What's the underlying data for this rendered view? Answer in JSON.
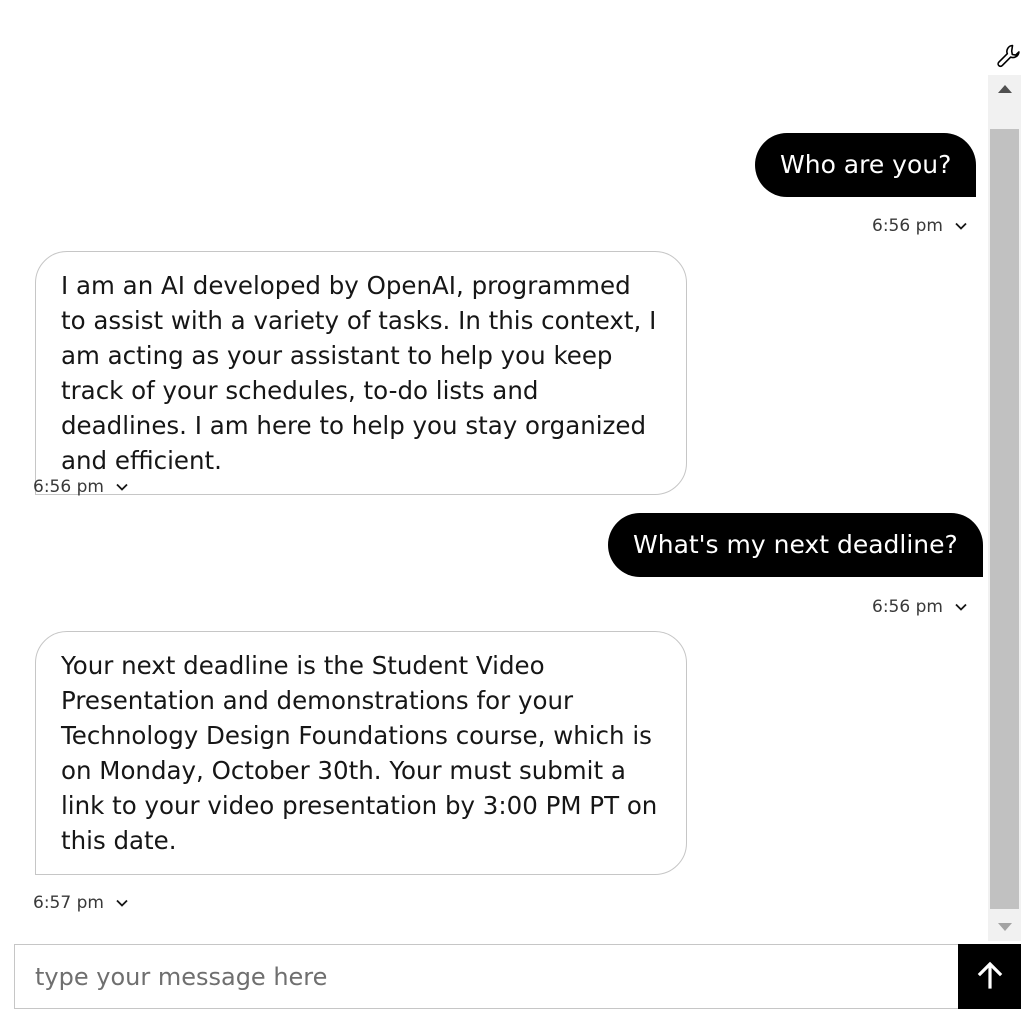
{
  "toolbar": {
    "settings_icon": "wrench-icon"
  },
  "messages": [
    {
      "role": "user",
      "text": "Who are you?",
      "time": "6:56 pm"
    },
    {
      "role": "assistant",
      "text": "I am an AI developed by OpenAI, programmed to assist with a variety of tasks. In this context, I am acting as your assistant to help you keep track of your schedules, to-do lists and deadlines. I am here to help you stay organized and efficient.",
      "time": "6:56 pm"
    },
    {
      "role": "user",
      "text": "What's my next deadline?",
      "time": "6:56 pm"
    },
    {
      "role": "assistant",
      "text": "Your next deadline is the Student Video Presentation and demonstrations for your Technology Design Foundations course, which is on Monday, October 30th. Your must submit a link to your video presentation by 3:00 PM PT on this date.",
      "time": "6:57 pm"
    }
  ],
  "composer": {
    "placeholder": "type your message here",
    "value": "",
    "send_icon": "arrow-up-icon"
  },
  "colors": {
    "user_bubble": "#000000",
    "assistant_border": "#c6c6c6",
    "send_button": "#000000"
  }
}
